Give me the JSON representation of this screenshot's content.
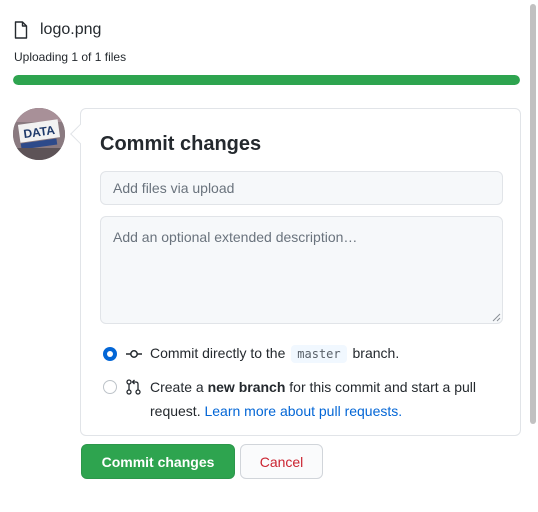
{
  "file": {
    "name": "logo.png",
    "icon": "file-icon"
  },
  "upload": {
    "status": "Uploading 1 of 1 files",
    "progress_percent": 100,
    "progress_color": "#2ea44f"
  },
  "avatar": {
    "text_top": "DATA"
  },
  "commit": {
    "title": "Commit changes",
    "summary_placeholder": "Add files via upload",
    "description_placeholder": "Add an optional extended description…",
    "option_direct": {
      "prefix": "Commit directly to the",
      "branch": "master",
      "suffix": "branch.",
      "selected": true
    },
    "option_new_branch": {
      "prefix": "Create a",
      "bold": "new branch",
      "suffix": "for this commit and start a pull request.",
      "link": "Learn more about pull requests.",
      "selected": false
    }
  },
  "buttons": {
    "commit": "Commit changes",
    "cancel": "Cancel"
  },
  "colors": {
    "accent_green": "#2ea44f",
    "link_blue": "#0366d6",
    "danger_red": "#cb2431"
  }
}
